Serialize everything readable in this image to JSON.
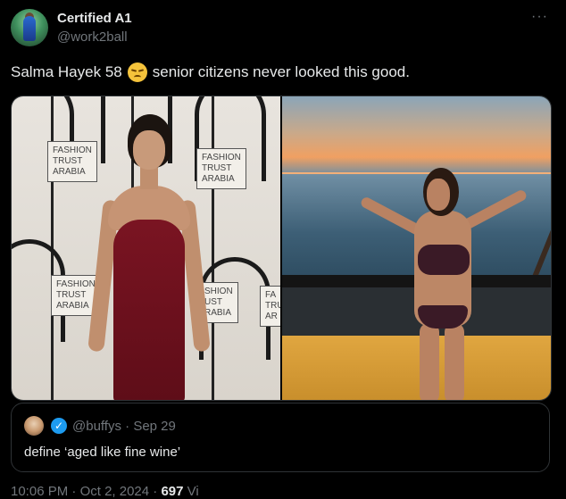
{
  "author": {
    "display_name": "Certified A1",
    "handle": "@work2ball"
  },
  "more_menu": "···",
  "tweet": {
    "text_before": "Salma Hayek 58",
    "emoji": "disappointed-relieved-face",
    "text_after": "senior citizens never looked this good."
  },
  "media": {
    "left_photo": {
      "signs": [
        "FASHION\nTRUST\nARABIA",
        "FASHION\nTRUST\nARABIA",
        "FASHION\nTRUST\nARABIA",
        "SHION\nUST\nRABIA",
        "FA\nTRU\nAR"
      ]
    }
  },
  "quoted_tweet": {
    "handle": "@buffys",
    "separator": "·",
    "date": "Sep 29",
    "text": "define ‘aged like fine wine’"
  },
  "footer": {
    "time": "10:06 PM",
    "separator": "·",
    "date": "Oct 2, 2024",
    "views_count": "697",
    "views_label": "Vi"
  },
  "colors": {
    "background": "#000000",
    "text_primary": "#e7e9ea",
    "text_secondary": "#71767b",
    "border": "#2f3336",
    "verified": "#1d9bf0"
  }
}
